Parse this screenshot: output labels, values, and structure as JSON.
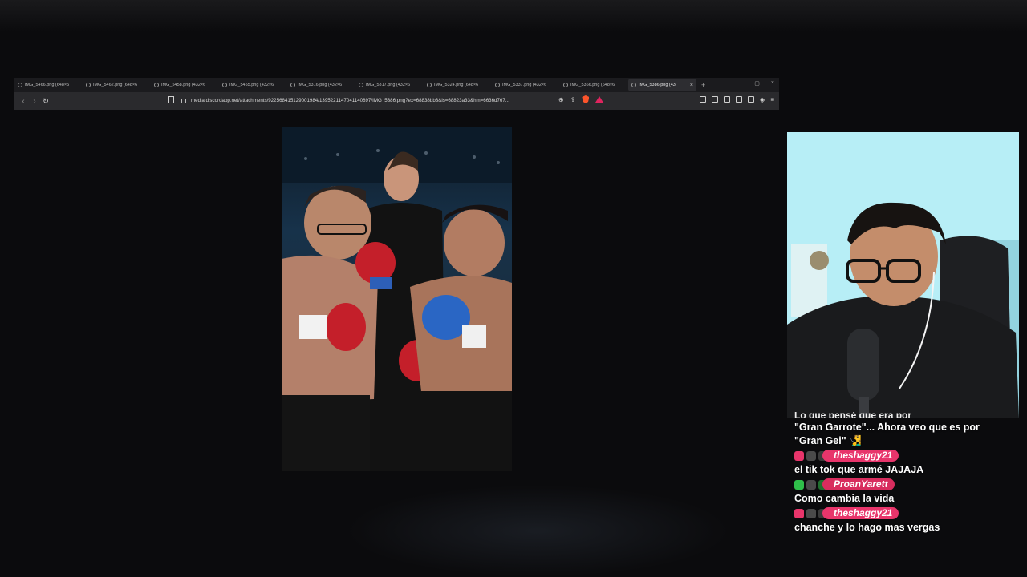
{
  "browser": {
    "tabs": [
      {
        "label": "IMG_5466.png (648×5",
        "active": false
      },
      {
        "label": "IMG_5462.png (648×6",
        "active": false
      },
      {
        "label": "IMG_5458.png (432×6",
        "active": false
      },
      {
        "label": "IMG_5455.png (432×6",
        "active": false
      },
      {
        "label": "IMG_5316.png (432×6",
        "active": false
      },
      {
        "label": "IMG_5317.png (432×6",
        "active": false
      },
      {
        "label": "IMG_5324.png (648×6",
        "active": false
      },
      {
        "label": "IMG_5337.png (432×6",
        "active": false
      },
      {
        "label": "IMG_5366.png (648×6",
        "active": false
      },
      {
        "label": "IMG_5386.png (43",
        "active": true
      }
    ],
    "new_tab_symbol": "+",
    "window_controls": [
      "–",
      "▢",
      "×"
    ],
    "url": "media.discordapp.net/attachments/922568415129001984/1395221147041140897/IMG_5386.png?ex=68838bb3&is=68823a33&hm=6636d767..."
  },
  "chat": {
    "cut_line": "Lo que pensé que era por",
    "messages": [
      {
        "user": "",
        "text": "\"Gran Garrote\"... Ahora veo que es por"
      },
      {
        "user": "",
        "text": "\"Gran Gei\" 🧏‍♂️"
      },
      {
        "user": "theshaggy21",
        "text": "el tik tok que armé JAJAJA"
      },
      {
        "user": "ProanYarett",
        "text": "Como cambia la vida"
      },
      {
        "user": "theshaggy21",
        "text": "chanche y lo hago mas vergas"
      }
    ]
  },
  "colors": {
    "badge_pink": "#e8356b",
    "badge_green": "#2fbf4a",
    "brave": "#fb542b"
  }
}
